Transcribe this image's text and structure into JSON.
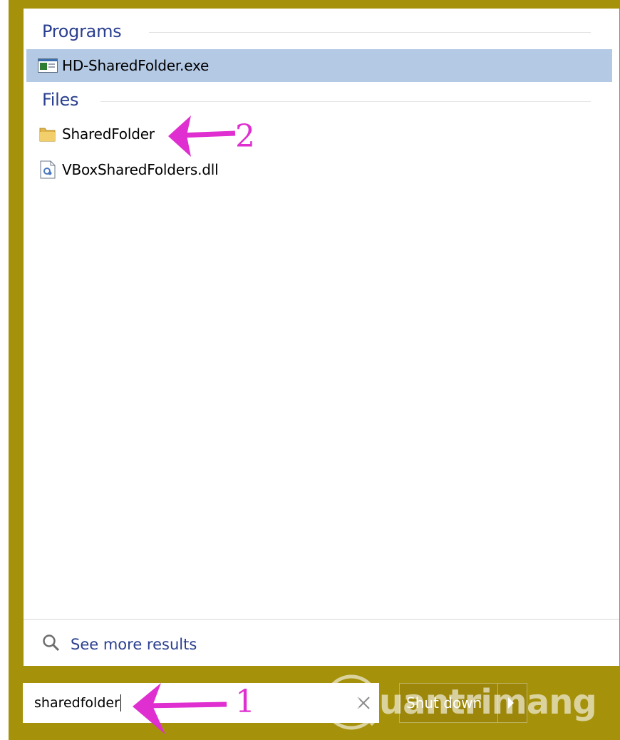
{
  "results": {
    "programs_header": "Programs",
    "files_header": "Files",
    "programs": [
      {
        "label": "HD-SharedFolder.exe",
        "icon": "exe-window-icon",
        "selected": true
      }
    ],
    "files": [
      {
        "label": "SharedFolder",
        "icon": "folder-icon"
      },
      {
        "label": "VBoxSharedFolders.dll",
        "icon": "dll-file-icon"
      }
    ],
    "see_more": "See more results"
  },
  "search": {
    "value": "sharedfolder"
  },
  "shutdown": {
    "label": "Shut down"
  },
  "annotations": {
    "step1": "1",
    "step2": "2"
  },
  "watermark": {
    "text": "uantrimang"
  },
  "colors": {
    "frame": "#a6910b",
    "accent_text": "#2a3f8f",
    "selection": "#b4c9e4",
    "annotation": "#e02fd0"
  }
}
